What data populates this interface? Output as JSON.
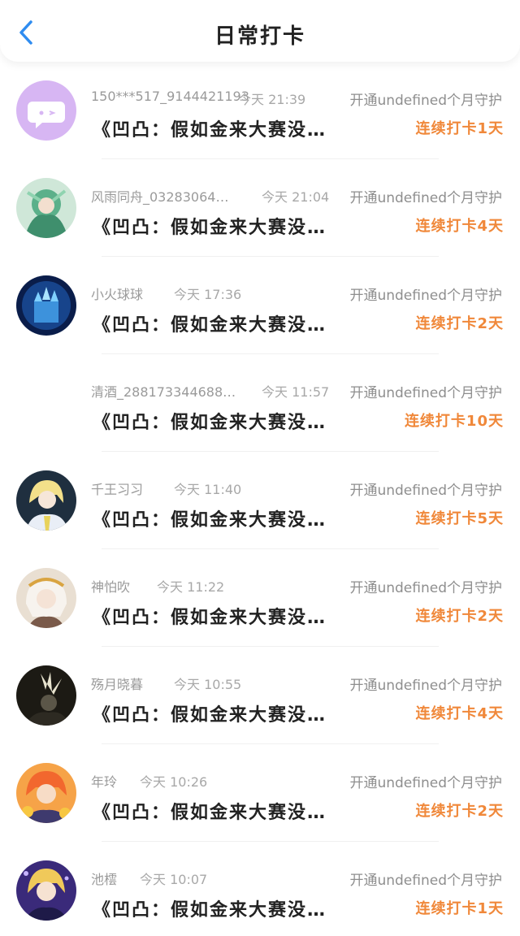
{
  "header": {
    "title": "日常打卡",
    "back_icon": "chevron-left-icon"
  },
  "colors": {
    "accent_blue": "#2f8cf0",
    "streak_orange": "#f0883a"
  },
  "rows": [
    {
      "name": "150***517_9144421193",
      "time": "今天 21:39",
      "open": "开通undefined个月守护",
      "message": "《凹凸：假如金来大赛没…",
      "streak": "连续打卡1天",
      "avatar": "default-chat-avatar"
    },
    {
      "name": "风雨同舟_03283064…",
      "time": "今天 21:04",
      "open": "开通undefined个月守护",
      "message": "《凹凸：假如金来大赛没…",
      "streak": "连续打卡4天",
      "avatar": "green-anime-avatar"
    },
    {
      "name": "小火球球",
      "time": "今天 17:36",
      "open": "开通undefined个月守护",
      "message": "《凹凸：假如金来大赛没…",
      "streak": "连续打卡2天",
      "avatar": "blue-castle-avatar"
    },
    {
      "name": "清酒_288173344688…",
      "time": "今天 11:57",
      "open": "开通undefined个月守护",
      "message": "《凹凸：假如金来大赛没…",
      "streak": "连续打卡10天",
      "avatar": "empty-avatar"
    },
    {
      "name": "千王习习",
      "time": "今天 11:40",
      "open": "开通undefined个月守护",
      "message": "《凹凸：假如金来大赛没…",
      "streak": "连续打卡5天",
      "avatar": "blonde-anime-avatar"
    },
    {
      "name": "神怕吹",
      "time": "今天 11:22",
      "open": "开通undefined个月守护",
      "message": "《凹凸：假如金来大赛没…",
      "streak": "连续打卡2天",
      "avatar": "white-hair-anime-avatar"
    },
    {
      "name": "殇月晓暮",
      "time": "今天 10:55",
      "open": "开通undefined个月守护",
      "message": "《凹凸：假如金来大赛没…",
      "streak": "连续打卡4天",
      "avatar": "dark-anime-avatar"
    },
    {
      "name": "年玲",
      "time": "今天 10:26",
      "open": "开通undefined个月守护",
      "message": "《凹凸：假如金来大赛没…",
      "streak": "连续打卡2天",
      "avatar": "orange-anime-avatar"
    },
    {
      "name": "池橒",
      "time": "今天 10:07",
      "open": "开通undefined个月守护",
      "message": "《凹凸：假如金来大赛没…",
      "streak": "连续打卡1天",
      "avatar": "purple-anime-avatar"
    }
  ]
}
